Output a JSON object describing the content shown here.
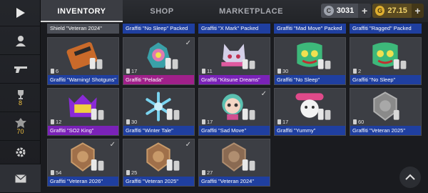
{
  "tabs": [
    {
      "label": "INVENTORY",
      "active": true
    },
    {
      "label": "SHOP",
      "active": false
    },
    {
      "label": "MARKETPLACE",
      "active": false
    }
  ],
  "currency": {
    "silver": "3031",
    "gold": "27.15"
  },
  "sidebar": {
    "items": [
      {
        "icon": "play-icon"
      },
      {
        "icon": "profile-icon"
      },
      {
        "icon": "weapon-icon"
      },
      {
        "icon": "trophy-icon",
        "badge": "8"
      },
      {
        "icon": "rank-icon",
        "badge": "70"
      },
      {
        "icon": "gear-icon"
      },
      {
        "icon": "mail-icon"
      }
    ]
  },
  "top_strip": [
    {
      "label": "Shield \"Veteran 2024\"",
      "rarity": "gray"
    },
    {
      "label": "Graffiti \"No Sleep\" Packed",
      "rarity": "blue"
    },
    {
      "label": "Graffiti \"X Mark\" Packed",
      "rarity": "blue"
    },
    {
      "label": "Graffiti \"Mad Move\" Packed",
      "rarity": "blue"
    },
    {
      "label": "Graffiti \"Ragged\" Packed",
      "rarity": "blue"
    }
  ],
  "items": [
    {
      "label": "Graffiti \"Warning! Shotguns\"",
      "count": "6",
      "rarity": "blue",
      "checked": false
    },
    {
      "label": "Graffiti \"Pelada\"",
      "count": "17",
      "rarity": "pink",
      "checked": true
    },
    {
      "label": "Graffiti \"Kitsune Dreams\"",
      "count": "11",
      "rarity": "purple",
      "checked": false
    },
    {
      "label": "Graffiti \"No Sleep\"",
      "count": "30",
      "rarity": "blue",
      "checked": false
    },
    {
      "label": "Graffiti \"No Sleep\"",
      "count": "2",
      "rarity": "blue",
      "checked": false
    },
    {
      "label": "Graffiti \"SO2 King\"",
      "count": "12",
      "rarity": "purple",
      "checked": false
    },
    {
      "label": "Graffiti \"Winter Tale\"",
      "count": "30",
      "rarity": "blue",
      "checked": false
    },
    {
      "label": "Graffiti \"Sad Move\"",
      "count": "17",
      "rarity": "blue",
      "checked": true
    },
    {
      "label": "Graffiti \"Yummy\"",
      "count": "17",
      "rarity": "blue",
      "checked": false
    },
    {
      "label": "Graffiti \"Veteran 2025\"",
      "count": "60",
      "rarity": "blue",
      "checked": false
    },
    {
      "label": "Graffiti \"Veteran 2026\"",
      "count": "54",
      "rarity": "blue",
      "checked": true
    },
    {
      "label": "Graffiti \"Veteran 2025\"",
      "count": "25",
      "rarity": "blue",
      "checked": true
    },
    {
      "label": "Graffiti \"Veteran 2024\"",
      "count": "27",
      "rarity": "blue",
      "checked": false
    }
  ]
}
